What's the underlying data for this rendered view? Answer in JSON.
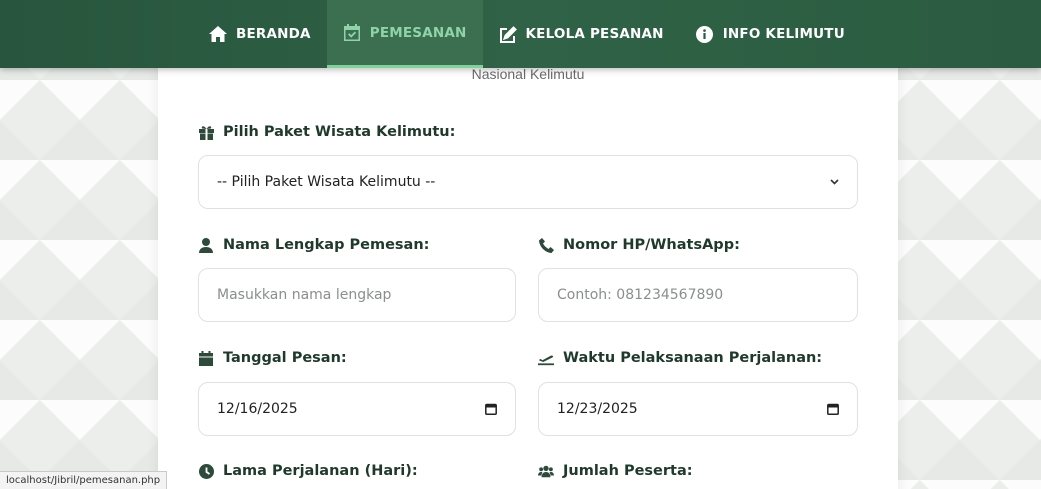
{
  "nav": {
    "items": [
      {
        "label": "BERANDA",
        "icon": "home-icon"
      },
      {
        "label": "PEMESANAN",
        "icon": "calendar-check-icon",
        "active": true
      },
      {
        "label": "KELOLA PESANAN",
        "icon": "edit-icon"
      },
      {
        "label": "INFO KELIMUTU",
        "icon": "info-circle-icon"
      }
    ],
    "colors": {
      "bar": "#2b5c41",
      "active": "#8fd4a8"
    }
  },
  "form": {
    "subtitle": "Nasional Kelimutu",
    "paket": {
      "label": "Pilih Paket Wisata Kelimutu:",
      "selected": "-- Pilih Paket Wisata Kelimutu --",
      "icon": "gift-icon"
    },
    "nama": {
      "label": "Nama Lengkap Pemesan:",
      "placeholder": "Masukkan nama lengkap",
      "icon": "user-icon"
    },
    "hp": {
      "label": "Nomor HP/WhatsApp:",
      "placeholder": "Contoh: 081234567890",
      "icon": "phone-icon"
    },
    "tanggal": {
      "label": "Tanggal Pesan:",
      "value": "12/16/2025",
      "icon": "calendar-icon"
    },
    "waktu": {
      "label": "Waktu Pelaksanaan Perjalanan:",
      "value": "12/23/2025",
      "icon": "plane-departure-icon"
    },
    "lama": {
      "label": "Lama Perjalanan (Hari):",
      "icon": "clock-icon"
    },
    "peserta": {
      "label": "Jumlah Peserta:",
      "icon": "users-icon"
    }
  },
  "status_bar": {
    "url": "localhost/Jibril/pemesanan.php"
  }
}
